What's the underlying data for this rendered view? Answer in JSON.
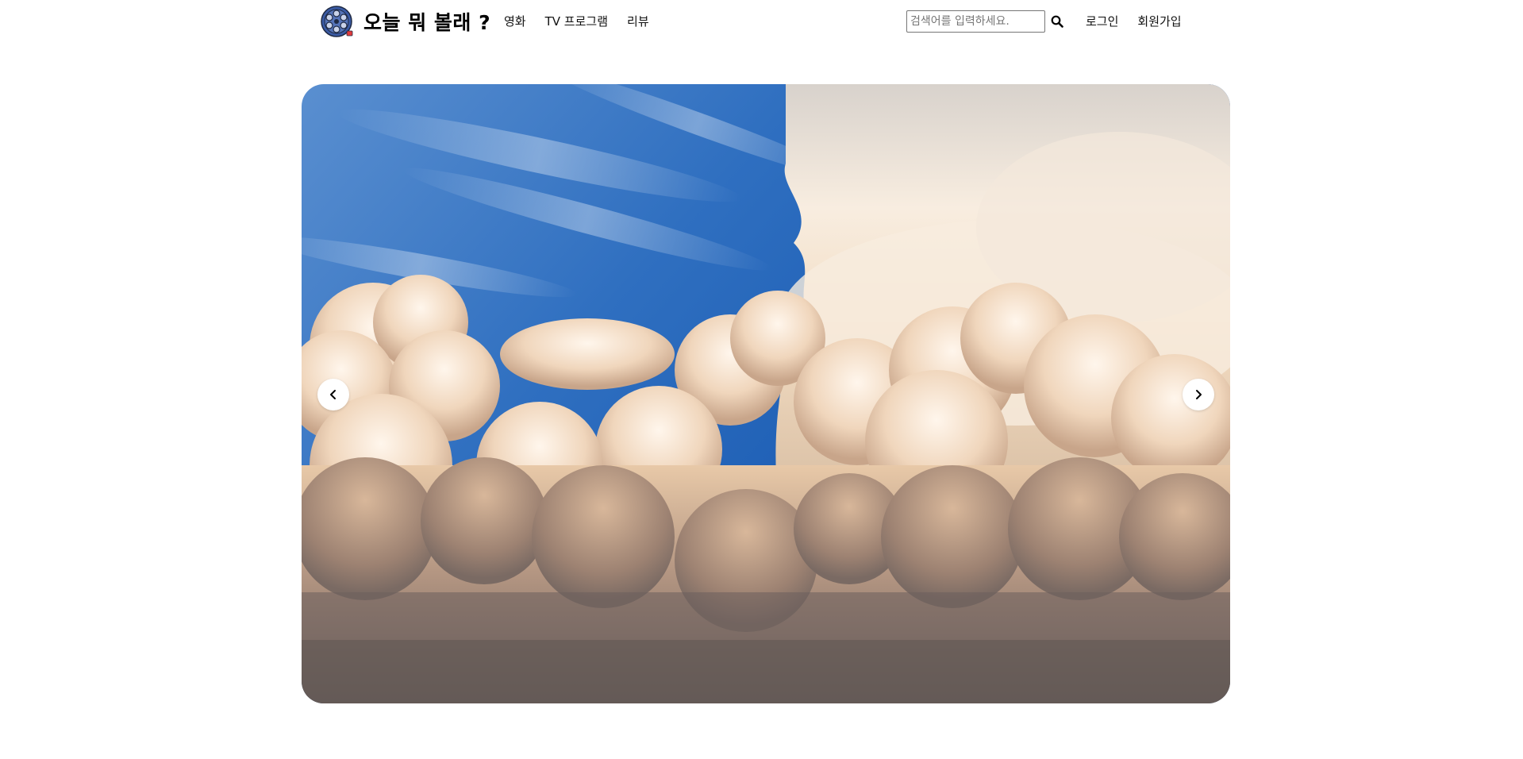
{
  "header": {
    "logo_text": "오늘 뭐 볼래 ?",
    "logo_icon": "film-reel-icon",
    "nav": [
      {
        "label": "영화"
      },
      {
        "label": "TV 프로그램"
      },
      {
        "label": "리뷰"
      }
    ],
    "search": {
      "placeholder": "검색어를 입력하세요.",
      "value": "",
      "icon": "search-icon"
    },
    "auth": {
      "login_label": "로그인",
      "signup_label": "회원가입"
    }
  },
  "carousel": {
    "slide_image": "cumulus-clouds-sky",
    "prev_icon": "chevron-left-icon",
    "next_icon": "chevron-right-icon"
  },
  "colors": {
    "sky_blue": "#2f6fc0",
    "cloud_cream": "#f6e6d2",
    "cloud_shadow": "#8b7b72",
    "logo_blue": "#3a5ba5",
    "logo_red": "#e23b3b"
  }
}
